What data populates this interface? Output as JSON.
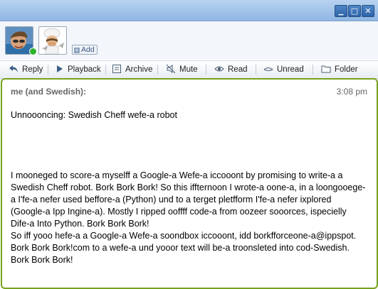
{
  "window": {
    "controls": {
      "minimize": "▁",
      "maximize": "□",
      "close": "✕"
    }
  },
  "participants": {
    "add_label": "Add",
    "online_status_color": "#2bb32b"
  },
  "toolbar": {
    "items": [
      {
        "label": "Reply",
        "icon": "reply-icon"
      },
      {
        "label": "Playback",
        "icon": "playback-icon"
      },
      {
        "label": "Archive",
        "icon": "archive-icon"
      },
      {
        "label": "Mute",
        "icon": "mute-icon"
      },
      {
        "label": "Read",
        "icon": "eye-icon"
      },
      {
        "label": "Unread",
        "icon": "unread-icon"
      },
      {
        "label": "Folder",
        "icon": "folder-icon"
      }
    ]
  },
  "blip": {
    "author": "me (and Swedish):",
    "time": "3:08 pm",
    "border_color": "#77a21c",
    "title_line": "Unnoooncing: Swedish Cheff wefe-a robot",
    "paragraph_1": "I mooneged to score-a myselff a Google-a Wefe-a iccooont by promising to write-a a Swedish Cheff robot. Bork Bork Bork! So this iffternoon I wrote-a oone-a, in a loongooege-a I'fe-a nefer used beffore-a (Python) und to a terget pletfform I'fe-a nefer ixplored (Google-a Ipp Ingine-a). Mostly I ripped ooffff code-a from oozeer sooorces, ispecielly Dife-a Into Python. Bork Bork Bork!",
    "paragraph_2": "So iff yooo hefe-a a Google-a Wefe-a soondbox iccooont, idd borkfforceone-a@ippspot. Bork Bork Bork!com to a wefe-a und yooor text will be-a troonsleted into cod-Swedish. Bork Bork Bork!"
  }
}
